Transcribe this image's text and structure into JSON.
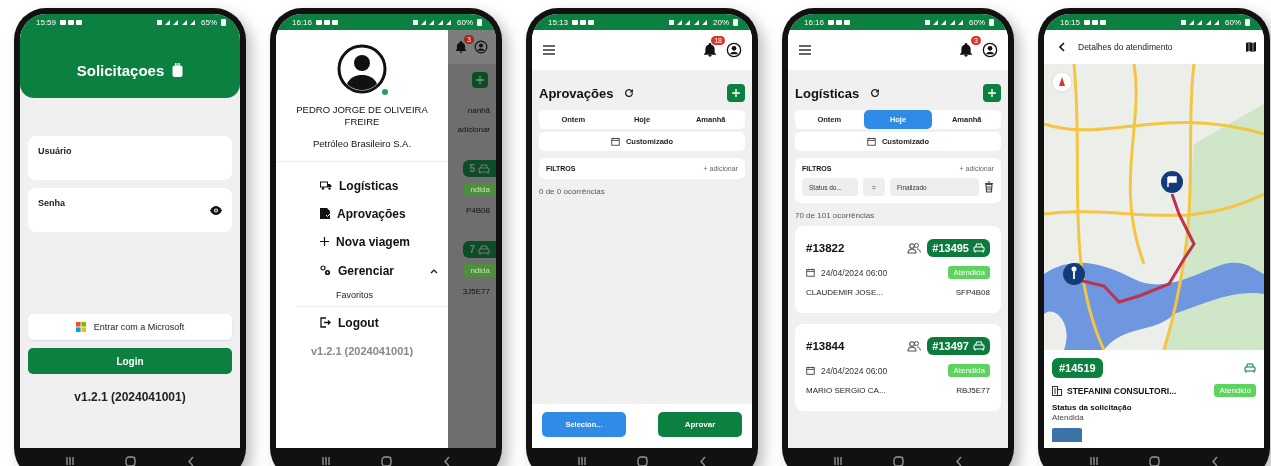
{
  "phones": [
    {
      "kind": "login",
      "status_bar": {
        "time": "15:59",
        "battery": "65%"
      },
      "header": {
        "title": "Solicitaçoes"
      },
      "fields": [
        {
          "label": "Usuário",
          "kind": "text"
        },
        {
          "label": "Senha",
          "kind": "password"
        }
      ],
      "microsoft_button": "Entrar com a Microsoft",
      "login_button": "Login",
      "version": "v1.2.1 (2024041001)"
    },
    {
      "kind": "drawer",
      "status_bar": {
        "time": "16:16",
        "battery": "60%"
      },
      "user": {
        "name": "PEDRO JORGE DE OLIVEIRA FREIRE",
        "company": "Petróleo Brasileiro S.A."
      },
      "menu": [
        {
          "label": "Logísticas"
        },
        {
          "label": "Aprovações"
        },
        {
          "label": "Nova viagem"
        },
        {
          "label": "Gerenciar",
          "expanded": true,
          "children": [
            {
              "label": "Favoritos"
            }
          ]
        },
        {
          "label": "Logout"
        }
      ],
      "version": "v1.2.1 (2024041001)",
      "background": {
        "notification_count": "3",
        "fragments": [
          {
            "kind": "text",
            "text": "nanhã"
          },
          {
            "kind": "text",
            "text": "adicionar"
          },
          {
            "kind": "badge",
            "text": "5"
          },
          {
            "kind": "status",
            "text": "ndida"
          },
          {
            "kind": "text",
            "text": "P4B08"
          },
          {
            "kind": "badge",
            "text": "7"
          },
          {
            "kind": "status",
            "text": "ndida"
          },
          {
            "kind": "text",
            "text": "3J5E77"
          }
        ]
      }
    },
    {
      "kind": "list",
      "status_bar": {
        "time": "15:13",
        "battery": "20%"
      },
      "notification_count": "18",
      "title": "Aprovações",
      "date_tabs": [
        {
          "label": "Ontem",
          "selected": false
        },
        {
          "label": "Hoje",
          "selected": false
        },
        {
          "label": "Amanhã",
          "selected": false
        }
      ],
      "custom_range": "Customizado",
      "filters": {
        "title": "FILTROS",
        "add": "+ adicionar"
      },
      "count": "0 de 0 ocorrências",
      "footer_buttons": [
        {
          "label": "Selecion...",
          "kind": "secondary"
        },
        {
          "label": "Aprovar",
          "kind": "primary"
        }
      ]
    },
    {
      "kind": "list",
      "status_bar": {
        "time": "16:16",
        "battery": "60%"
      },
      "notification_count": "3",
      "title": "Logísticas",
      "date_tabs": [
        {
          "label": "Ontem",
          "selected": false
        },
        {
          "label": "Hoje",
          "selected": true
        },
        {
          "label": "Amanhã",
          "selected": false
        }
      ],
      "custom_range": "Customizado",
      "filters": {
        "title": "FILTROS",
        "add": "+ adicionar",
        "rows": [
          {
            "field": "Status do...",
            "operator": "=",
            "value": "Finalizado"
          }
        ]
      },
      "count": "70 de 101 ocorrências",
      "cards": [
        {
          "id": "#13822",
          "trip": "#13495",
          "date": "24/04/2024 06:00",
          "status": "Atendida",
          "name": "CLAUDEMIR JOSE...",
          "plate": "SFP4B08"
        },
        {
          "id": "#13844",
          "trip": "#13497",
          "date": "24/04/2024 06:00",
          "status": "Atendida",
          "name": "MARIO SERGIO CA...",
          "plate": "RBJ5E77"
        }
      ]
    },
    {
      "kind": "detail",
      "status_bar": {
        "time": "16:15",
        "battery": "60%"
      },
      "title": "Detalhes do atendimento",
      "request_id": "#14519",
      "company": "STEFANINI CONSULTORI...",
      "status_badge": "Atendido",
      "status_label": "Status da solicitação",
      "status_value": "Atendida"
    }
  ]
}
